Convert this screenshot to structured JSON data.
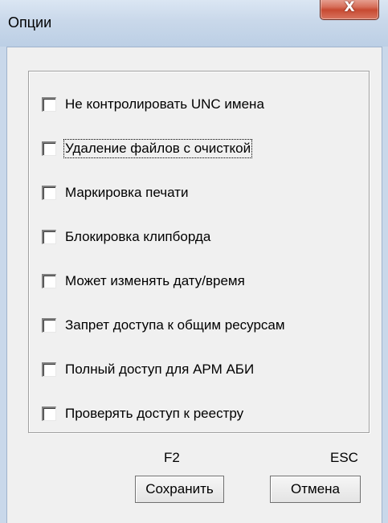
{
  "window": {
    "title": "Опции",
    "close_glyph": "X"
  },
  "options": [
    {
      "label": "Не контролировать UNC имена",
      "checked": false
    },
    {
      "label": "Удаление файлов с очисткой",
      "checked": false,
      "focused": true
    },
    {
      "label": "Маркировка печати",
      "checked": false
    },
    {
      "label": "Блокировка клипборда",
      "checked": false
    },
    {
      "label": "Может изменять дату/время",
      "checked": false
    },
    {
      "label": "Запрет доступа к общим ресурсам",
      "checked": false
    },
    {
      "label": "Полный доступ для АРМ АБИ",
      "checked": false
    },
    {
      "label": "Проверять доступ к реестру",
      "checked": false
    }
  ],
  "buttons": {
    "save": {
      "label": "Сохранить",
      "hotkey": "F2"
    },
    "cancel": {
      "label": "Отмена",
      "hotkey": "ESC"
    }
  }
}
